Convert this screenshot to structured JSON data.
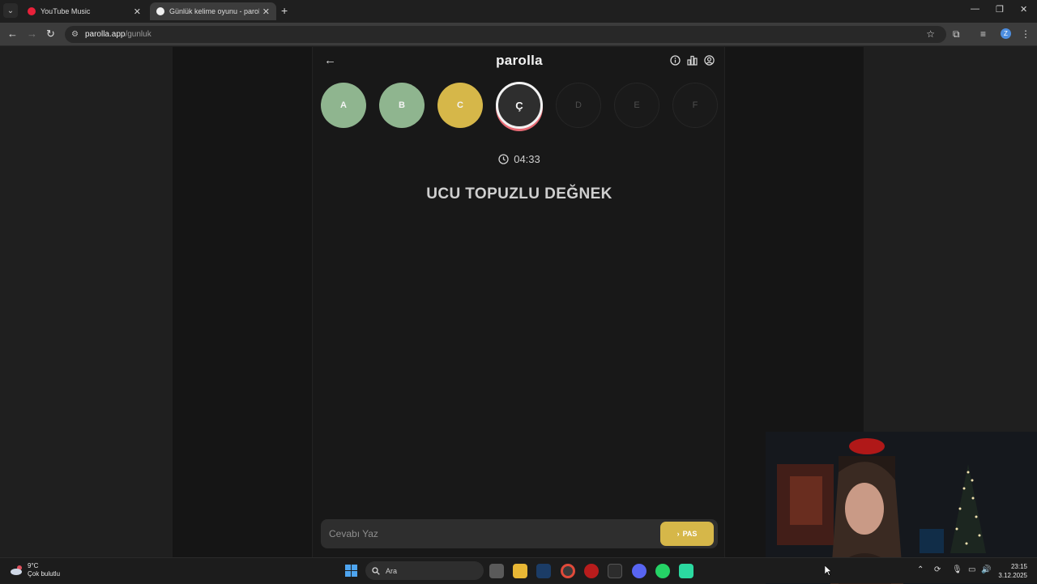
{
  "browser": {
    "tabs": [
      {
        "title": "YouTube Music",
        "active": false
      },
      {
        "title": "Günlük kelime oyunu - parolla",
        "active": true
      }
    ],
    "url_host": "parolla.app",
    "url_path": "/gunluk",
    "profile_initial": "Z"
  },
  "app": {
    "logo": "parolla",
    "letters": [
      {
        "char": "A",
        "state": "correct"
      },
      {
        "char": "B",
        "state": "correct"
      },
      {
        "char": "C",
        "state": "passed"
      },
      {
        "char": "Ç",
        "state": "current"
      },
      {
        "char": "D",
        "state": "pending"
      },
      {
        "char": "E",
        "state": "pending"
      },
      {
        "char": "F",
        "state": "pending"
      }
    ],
    "timer": "04:33",
    "question": "UCU TOPUZLU DEĞNEK",
    "answer_placeholder": "Cevabı Yaz",
    "pass_label": "PAS"
  },
  "colors": {
    "correct": "#8fb58f",
    "passed": "#d6b749",
    "current_ring": "#e86b75"
  },
  "taskbar": {
    "weather_temp": "9°C",
    "weather_desc": "Çok bulutlu",
    "search_label": "Ara",
    "time": "23:15",
    "date": "3.12.2025"
  }
}
